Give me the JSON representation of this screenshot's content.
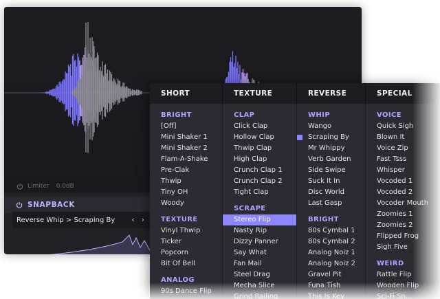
{
  "limiter": {
    "label": "Limiter",
    "value": "0.0dB"
  },
  "snapback": {
    "label": "SNAPBACK"
  },
  "preset": {
    "name": "Reverse Whip > Scraping By",
    "prev_icon": "‹",
    "next_icon": "›"
  },
  "colors": {
    "accent": "#8c86ff",
    "section": "#a9a5ff",
    "wave_purple": "#7b74ff",
    "wave_pink": "#c6a3ff",
    "wave_gray": "#8e8e94"
  },
  "menu": {
    "columns": [
      {
        "header": "SHORT",
        "entries": [
          {
            "type": "section",
            "text": "BRIGHT"
          },
          {
            "type": "item",
            "text": "[Off]"
          },
          {
            "type": "item",
            "text": "Mini Shaker 1"
          },
          {
            "type": "item",
            "text": "Mini Shaker 2"
          },
          {
            "type": "item",
            "text": "Flam-A-Shake"
          },
          {
            "type": "item",
            "text": "Pre-Clak"
          },
          {
            "type": "item",
            "text": "Thwip"
          },
          {
            "type": "item",
            "text": "Tiny OH"
          },
          {
            "type": "item",
            "text": "Woody"
          },
          {
            "type": "gap"
          },
          {
            "type": "section",
            "text": "TEXTURE"
          },
          {
            "type": "item",
            "text": "Vinyl Thwip"
          },
          {
            "type": "item",
            "text": "Ticker"
          },
          {
            "type": "item",
            "text": "Popcorn"
          },
          {
            "type": "item",
            "text": "Bit Of Bell"
          },
          {
            "type": "gap"
          },
          {
            "type": "section",
            "text": "ANALOG"
          },
          {
            "type": "item",
            "text": "90s Dance Flip"
          }
        ]
      },
      {
        "header": "TEXTURE",
        "entries": [
          {
            "type": "section",
            "text": "CLAP"
          },
          {
            "type": "item",
            "text": "Click Clap"
          },
          {
            "type": "item",
            "text": "Hollow Clap"
          },
          {
            "type": "item",
            "text": "Thwip Clap"
          },
          {
            "type": "item",
            "text": "High Clap"
          },
          {
            "type": "item",
            "text": "Crunch Clap 1"
          },
          {
            "type": "item",
            "text": "Crunch Clap 2"
          },
          {
            "type": "item",
            "text": "Tight Clap"
          },
          {
            "type": "gap"
          },
          {
            "type": "section",
            "text": "SCRAPE"
          },
          {
            "type": "item",
            "text": "Stereo Flip",
            "state": "selected"
          },
          {
            "type": "item",
            "text": "Nasty Rip"
          },
          {
            "type": "item",
            "text": "Dizzy Panner"
          },
          {
            "type": "item",
            "text": "Say What"
          },
          {
            "type": "item",
            "text": "Fan Mail"
          },
          {
            "type": "item",
            "text": "Steel Drag"
          },
          {
            "type": "item",
            "text": "Mecha Slice"
          },
          {
            "type": "item",
            "text": "Grind Railing"
          }
        ]
      },
      {
        "header": "REVERSE",
        "entries": [
          {
            "type": "section",
            "text": "WHIP"
          },
          {
            "type": "item",
            "text": "Wango"
          },
          {
            "type": "item",
            "text": "Scraping By",
            "state": "checked"
          },
          {
            "type": "item",
            "text": "Mr Whippy"
          },
          {
            "type": "item",
            "text": "Verb Garden"
          },
          {
            "type": "item",
            "text": "Side Swipe"
          },
          {
            "type": "item",
            "text": "Suck It In"
          },
          {
            "type": "item",
            "text": "Disc World"
          },
          {
            "type": "item",
            "text": "Last Gasp"
          },
          {
            "type": "gap"
          },
          {
            "type": "section",
            "text": "BRIGHT"
          },
          {
            "type": "item",
            "text": "80s Cymbal 1"
          },
          {
            "type": "item",
            "text": "80s Cymbal 2"
          },
          {
            "type": "item",
            "text": "Analog Noiz 1"
          },
          {
            "type": "item",
            "text": "Analog Noiz 2"
          },
          {
            "type": "item",
            "text": "Gravel Pit"
          },
          {
            "type": "item",
            "text": "Funa Tish"
          },
          {
            "type": "item",
            "text": "This Is Key"
          }
        ]
      },
      {
        "header": "SPECIAL",
        "entries": [
          {
            "type": "section",
            "text": "VOICE"
          },
          {
            "type": "item",
            "text": "Quick Sigh"
          },
          {
            "type": "item",
            "text": "Blown It"
          },
          {
            "type": "item",
            "text": "Voice Zip"
          },
          {
            "type": "item",
            "text": "Fast Tsss"
          },
          {
            "type": "item",
            "text": "Whisper"
          },
          {
            "type": "item",
            "text": "Vocoded 1"
          },
          {
            "type": "item",
            "text": "Vocoded 2"
          },
          {
            "type": "item",
            "text": "Vocoder Mouth"
          },
          {
            "type": "item",
            "text": "Zoomies 1"
          },
          {
            "type": "item",
            "text": "Zoomies 2"
          },
          {
            "type": "item",
            "text": "Flipped Frog"
          },
          {
            "type": "item",
            "text": "Sigh Five"
          },
          {
            "type": "gap"
          },
          {
            "type": "section",
            "text": "WEIRD"
          },
          {
            "type": "item",
            "text": "Rattle Flip"
          },
          {
            "type": "item",
            "text": "Wooden Flip"
          },
          {
            "type": "item",
            "text": "Sci-Fi Sn..."
          }
        ]
      }
    ]
  }
}
